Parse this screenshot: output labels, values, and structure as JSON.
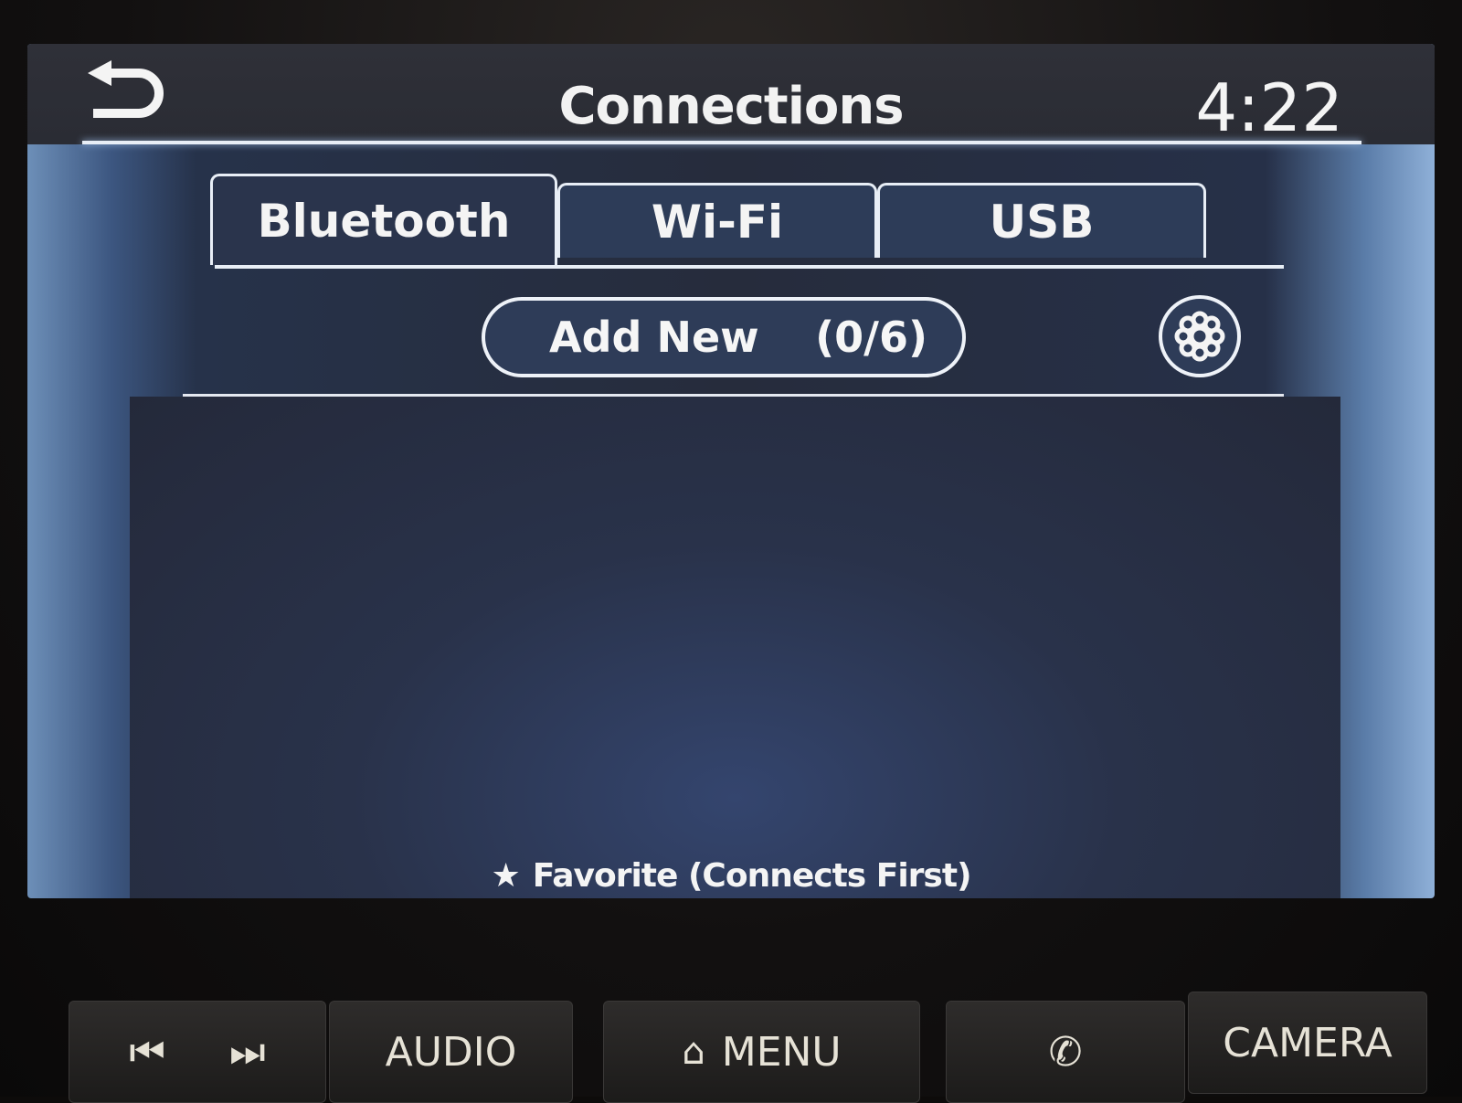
{
  "header": {
    "title": "Connections",
    "time": "4:22",
    "back_icon": "back-arrow-icon"
  },
  "tabs": [
    {
      "label": "Bluetooth",
      "active": true
    },
    {
      "label": "Wi-Fi",
      "active": false
    },
    {
      "label": "USB",
      "active": false
    }
  ],
  "add_new": {
    "label": "Add New",
    "count": "(0/6)"
  },
  "settings_icon": "gear-icon",
  "footer": {
    "icon": "star-icon",
    "text": "Favorite (Connects First)"
  },
  "hardware_buttons": {
    "prev_icon": "skip-previous-icon",
    "next_icon": "skip-next-icon",
    "audio": "AUDIO",
    "menu": "MENU",
    "menu_icon": "home-icon",
    "phone_icon": "phone-icon",
    "camera": "CAMERA"
  },
  "colors": {
    "panel": "#2a344c",
    "accent_line": "#e8eef6"
  }
}
